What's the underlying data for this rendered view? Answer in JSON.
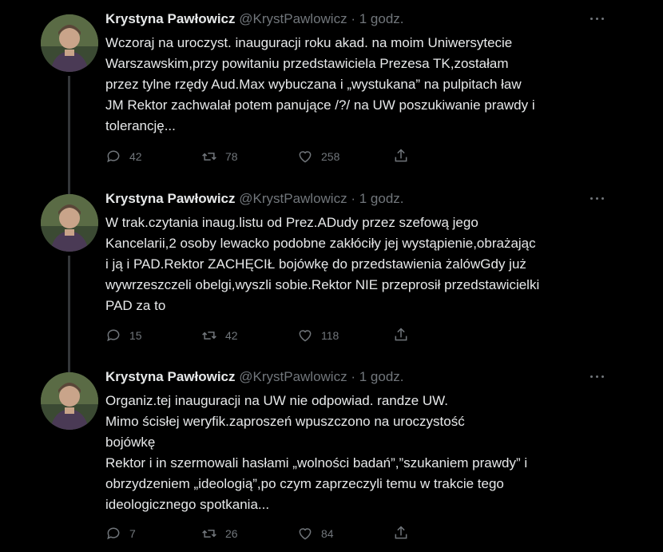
{
  "tweets": [
    {
      "name": "Krystyna Pawłowicz",
      "handle": "@KrystPawlowicz",
      "separator": "·",
      "time": "1 godz.",
      "lines": [
        "Wczoraj na uroczyst. inauguracji roku akad. na moim Uniwersytecie",
        "Warszawskim,przy powitaniu przedstawiciela Prezesa TK,zostałam",
        "przez tylne rzędy Aud.Max wybuczana i „wystukana” na pulpitach ław",
        "JM Rektor zachwalał potem panujące /?/ na UW poszukiwanie prawdy i",
        "tolerancję..."
      ],
      "replies": "42",
      "retweets": "78",
      "likes": "258"
    },
    {
      "name": "Krystyna Pawłowicz",
      "handle": "@KrystPawlowicz",
      "separator": "·",
      "time": "1 godz.",
      "lines": [
        "W trak.czytania inaug.listu od Prez.ADudy przez szefową jego",
        "Kancelarii,2 osoby lewacko podobne zakłóciły jej wystąpienie,obrażając",
        "i ją i PAD.Rektor ZACHĘCIŁ bojówkę do przedstawienia żalówGdy już",
        "wywrzeszczeli obelgi,wyszli sobie.Rektor NIE przeprosił przedstawicielki",
        "PAD za to"
      ],
      "replies": "15",
      "retweets": "42",
      "likes": "118"
    },
    {
      "name": "Krystyna Pawłowicz",
      "handle": "@KrystPawlowicz",
      "separator": "·",
      "time": "1 godz.",
      "lines": [
        "Organiz.tej inauguracji na UW nie odpowiad. randze UW.",
        "Mimo ścisłej weryfik.zaproszeń wpuszczono na uroczystość",
        "bojówkę",
        "Rektor i in szermowali hasłami „wolności badań”,”szukaniem prawdy” i",
        "obrzydzeniem „ideologią”,po czym zaprzeczyli temu w trakcie tego",
        "ideologicznego spotkania..."
      ],
      "replies": "7",
      "retweets": "26",
      "likes": "84"
    }
  ],
  "icons": {
    "reply": "reply-icon",
    "retweet": "retweet-icon",
    "like": "heart-icon",
    "share": "share-icon",
    "more": "more-icon"
  },
  "colors": {
    "background": "#000000",
    "text": "#e7e9ea",
    "secondary": "#71767b",
    "thread_line": "#333639"
  }
}
